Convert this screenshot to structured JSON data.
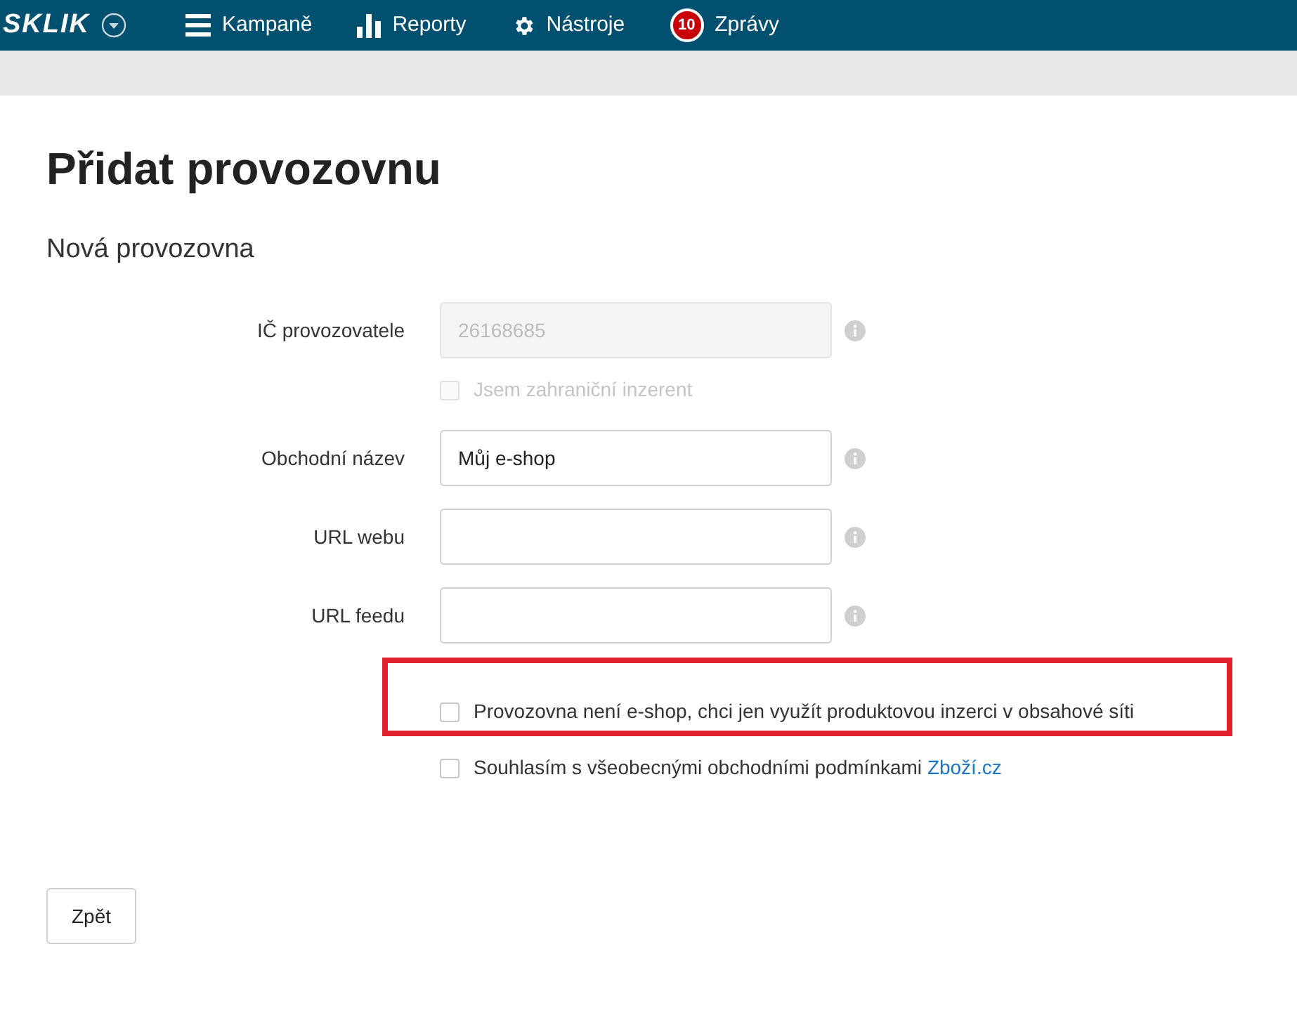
{
  "navbar": {
    "logo": "SKLIK",
    "items": [
      {
        "kind": "menu",
        "label": "Kampaně"
      },
      {
        "kind": "chart",
        "label": "Reporty"
      },
      {
        "kind": "gear",
        "label": "Nástroje"
      },
      {
        "kind": "messages",
        "badge": "10",
        "label": "Zprávy"
      }
    ]
  },
  "page": {
    "title": "Přidat provozovnu",
    "subtitle": "Nová provozovna"
  },
  "fields": [
    {
      "label": "IČ provozovatele",
      "value": "26168685",
      "disabled": true,
      "checkbox": {
        "label": "Jsem zahraniční inzerent",
        "checked": false,
        "disabled": true
      }
    },
    {
      "label": "Obchodní název",
      "value": "Můj e-shop",
      "disabled": false
    },
    {
      "label": "URL webu",
      "disabled": false
    },
    {
      "label": "URL feedu",
      "disabled": false
    }
  ],
  "options": [
    {
      "label": "Provozovna není e-shop, chci jen využít produktovou inzerci v obsahové síti",
      "checked": false,
      "highlighted": true
    },
    {
      "label": "Souhlasím s všeobecnými obchodními podmínkami",
      "link": "Zboží.cz",
      "checked": false,
      "highlighted": false
    }
  ],
  "back_button": "Zpět"
}
